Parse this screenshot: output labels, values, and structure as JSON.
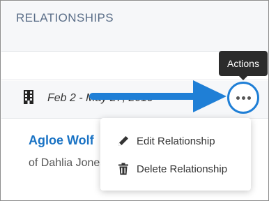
{
  "section": {
    "title": "RELATIONSHIPS"
  },
  "relationship": {
    "date_range": "Feb 2 - May 27, 2019",
    "name": "Agloe Wolf",
    "subtitle": "of Dahlia Jones"
  },
  "actions": {
    "tooltip": "Actions",
    "icon": "more-horizontal-icon"
  },
  "menu": {
    "items": [
      {
        "label": "Edit Relationship",
        "icon": "pencil-icon"
      },
      {
        "label": "Delete Relationship",
        "icon": "trash-icon"
      }
    ]
  },
  "colors": {
    "accent": "#1f7fd6",
    "link": "#1a73c4",
    "header_text": "#5a6e88"
  }
}
